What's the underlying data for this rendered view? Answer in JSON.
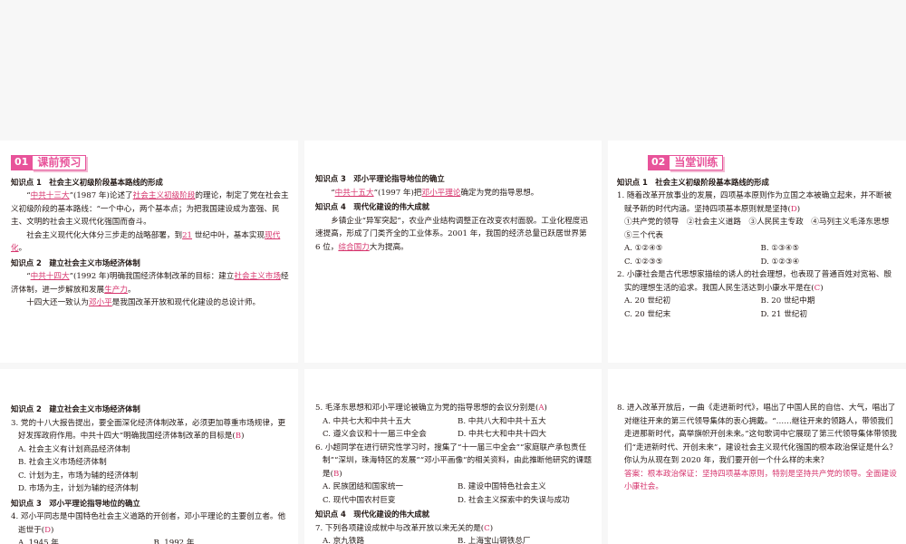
{
  "p1": {
    "sec_num": "01",
    "sec_title": "课前预习",
    "kp1_title": "知识点 1　社会主义初级阶段基本路线的形成",
    "kp1_a1": "“",
    "kp1_a2": "中共十三大",
    "kp1_a3": "”(1987 年)论述了",
    "kp1_a4": "社会主义初级阶段",
    "kp1_a5": "的理论，制定了党在社会主义初级阶段的基本路线：“一个中心，两个基本点；为把我国建设成为富强、民主、文明的社会主义现代化强国而奋斗。",
    "kp1_b1": "社会主义现代化大体分三步走的战略部署，到",
    "kp1_b2": "21",
    "kp1_b3": " 世纪中叶，基本实现",
    "kp1_b4": "现代化",
    "kp1_b5": "。",
    "kp2_title": "知识点 2　建立社会主义市场经济体制",
    "kp2_a1": "“",
    "kp2_a2": "中共十四大",
    "kp2_a3": "”(1992 年)明确我国经济体制改革的目标：建立",
    "kp2_a4": "社会主义市场",
    "kp2_a5": "经济体制，进一步解放和发展",
    "kp2_a6": "生产力",
    "kp2_a7": "。",
    "kp2_b1": "十四大还一致认为",
    "kp2_b2": "邓小平",
    "kp2_b3": "是我国改革开放和现代化建设的总设计师。"
  },
  "p2": {
    "kp3_title": "知识点 3　邓小平理论指导地位的确立",
    "kp3_a1": "“",
    "kp3_a2": "中共十五大",
    "kp3_a3": "”(1997 年)把",
    "kp3_a4": "邓小平理论",
    "kp3_a5": "确定为党的指导思想。",
    "kp4_title": "知识点 4　现代化建设的伟大成就",
    "kp4_a1": "乡镇企业“异军突起”，农业产业结构调整正在改变农村面貌。工业化程度迅速提高，形成了门类齐全的工业体系。2001 年，我国的经济总量已跃居世界第 6 位，",
    "kp4_a2": "综合国力",
    "kp4_a3": "大为提高。"
  },
  "p3": {
    "sec_num": "02",
    "sec_title": "当堂训练",
    "kp1_title": "知识点 1　社会主义初级阶段基本路线的形成",
    "q1_text": "1. 随着改革开放事业的发展，四项基本原则作为立国之本被确立起来，并不断被赋予新的时代内涵。坚持四项基本原则就是坚持(",
    "q1_ans": "D",
    "q1_close": ")",
    "q1_items": "①共产党的领导　②社会主义道路　③人民民主专政　④马列主义毛泽东思想　⑤三个代表",
    "q1_opts": [
      "A. ①②④⑤",
      "B. ①③④⑤",
      "C. ①②③⑤",
      "D. ①②③④"
    ],
    "q2_text": "2. 小康社会是古代思想家描绘的诱人的社会理想，也表现了普通百姓对宽裕、殷实的理想生活的追求。我国人民生活达到小康水平是在(",
    "q2_ans": "C",
    "q2_close": ")",
    "q2_opts": [
      "A. 20 世纪初",
      "B. 20 世纪中期",
      "C. 20 世纪末",
      "D. 21 世纪初"
    ]
  },
  "p4": {
    "kp2_title": "知识点 2　建立社会主义市场经济体制",
    "q3_text": "3. 党的十八大报告提出，要全面深化经济体制改革，必须更加尊重市场规律，更好发挥政府作用。中共十四大“明确我国经济体制改革的目标是(",
    "q3_ans": "B",
    "q3_close": ")",
    "q3_opts": [
      "A. 社会主义有计划商品经济体制",
      "B. 社会主义市场经济体制",
      "C. 计划为主，市场为辅的经济体制",
      "D. 市场为主，计划为辅的经济体制"
    ],
    "kp3_title": "知识点 3　邓小平理论指导地位的确立",
    "q4_text": "4. 邓小平同志是中国特色社会主义道路的开创者，邓小平理论的主要创立者。他逝世于(",
    "q4_ans": "D",
    "q4_close": ")",
    "q4_opts": [
      "A. 1945 年",
      "B. 1992 年"
    ]
  },
  "p5": {
    "q5_text": "5. 毛泽东思想和邓小平理论被确立为党的指导思想的会议分别是(",
    "q5_ans": "A",
    "q5_close": ")",
    "q5_opts": [
      "A. 中共七大和中共十五大",
      "B. 中共八大和中共十五大",
      "C. 遵义会议和十一届三中全会",
      "D. 中共七大和中共十四大"
    ],
    "q6_text": "6. 小超同学在进行研究性学习时，搜集了“十一届三中全会”“家庭联产承包责任制”“深圳，珠海特区的发展”“邓小平画像”的相关资料，由此推断他研究的课题是(",
    "q6_ans": "B",
    "q6_close": ")",
    "q6_opts": [
      "A. 民族团结和国家统一",
      "B. 建设中国特色社会主义",
      "C. 现代中国农村巨变",
      "D. 社会主义探索中的失误与成功"
    ],
    "kp4_title": "知识点 4　现代化建设的伟大成就",
    "q7_text": "7. 下列各项建设成就中与改革开放以来无关的是(",
    "q7_ans": "C",
    "q7_close": ")",
    "q7_opts": [
      "A. 京九铁路",
      "B. 上海宝山钢铁总厂"
    ]
  },
  "p6": {
    "q8_text": "8. 进入改革开放后，一曲《走进新时代》，唱出了中国人民的自信、大气，唱出了对继往开来的第三代领导集体的衷心拥戴。“……继往开来的领路人，带领我们走进那新时代，高举旗帜开创未来。”这句歌词中它展现了第三代领导集体带领我们“走进新时代、开创未来”，建设社会主义现代化强国的根本政治保证是什么？你认为从现在到 2020 年，我们要开创一个什么样的未来？",
    "q8_answer": "答案：根本政治保证：坚持四项基本原则，特别是坚持共产党的领导。全面建设小康社会。"
  }
}
